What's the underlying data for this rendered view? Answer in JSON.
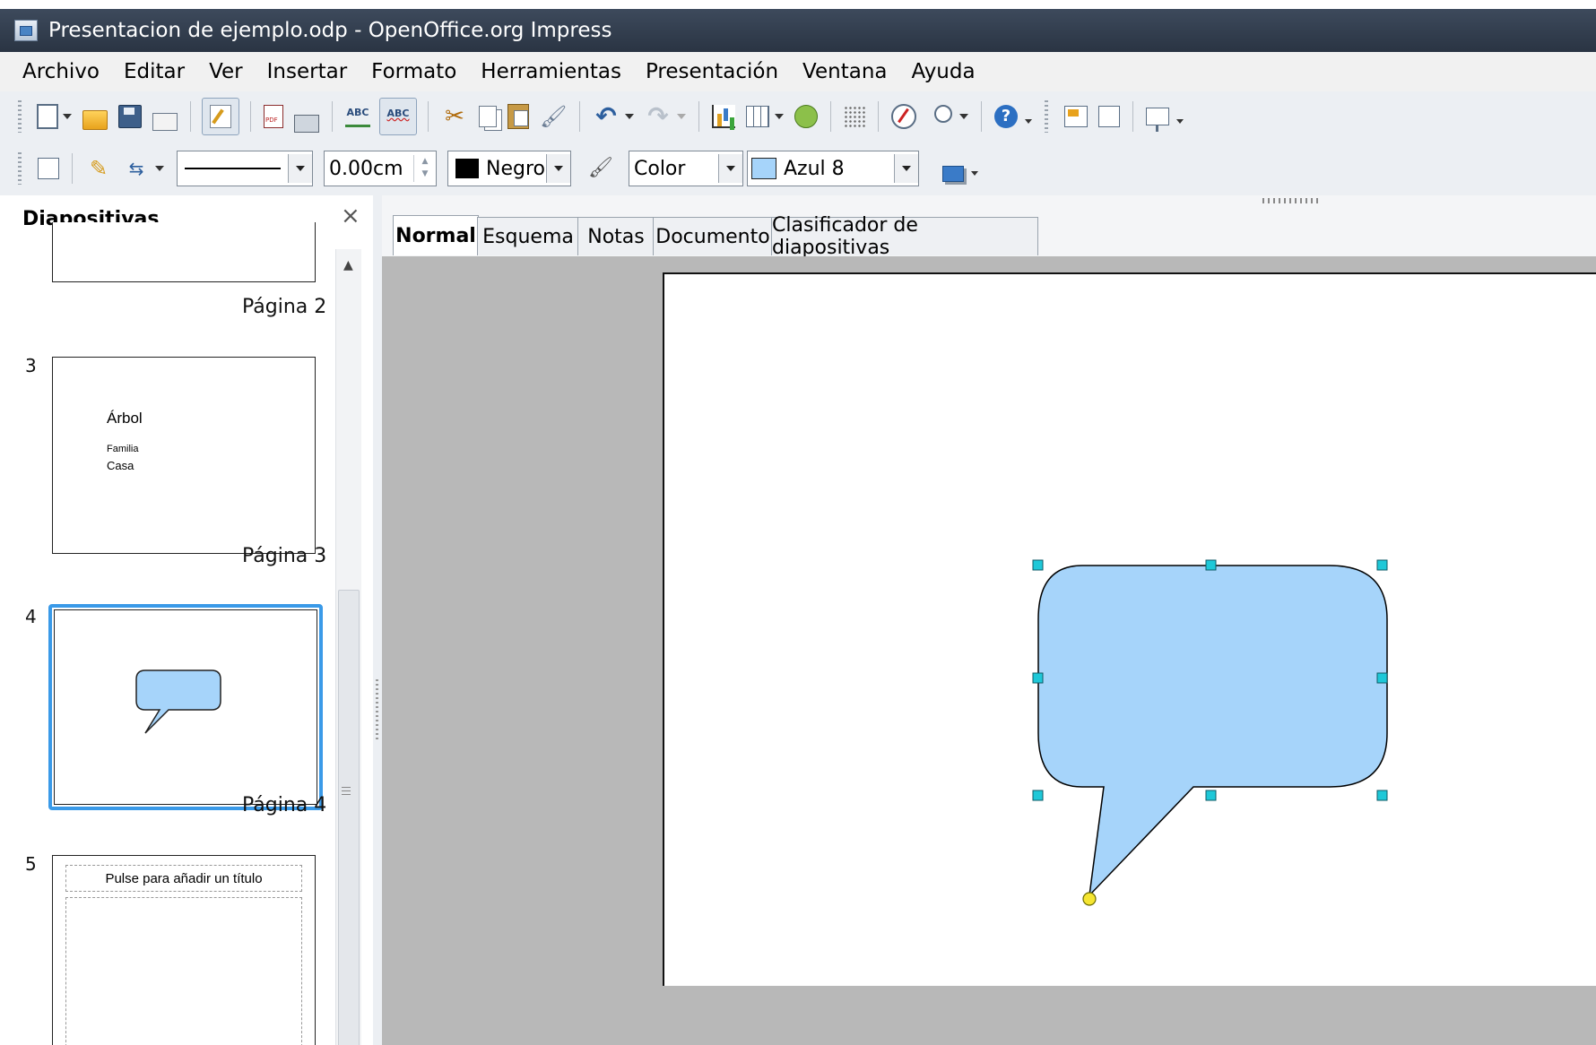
{
  "window": {
    "title": "Presentacion de ejemplo.odp - OpenOffice.org Impress"
  },
  "menu": [
    "Archivo",
    "Editar",
    "Ver",
    "Insertar",
    "Formato",
    "Herramientas",
    "Presentación",
    "Ventana",
    "Ayuda"
  ],
  "line_toolbar": {
    "line_width": "0.00cm",
    "line_color": "Negro",
    "line_color_hex": "#000000",
    "area_style": "Color",
    "area_color": "Azul 8",
    "area_color_hex": "#a6d4fa"
  },
  "slides_panel": {
    "title": "Diapositivas",
    "close_symbol": "×",
    "slides": [
      {
        "number": "",
        "label": "Página 2"
      },
      {
        "number": "3",
        "label": "Página 3",
        "lines": [
          "Árbol",
          "Familia",
          "Casa"
        ]
      },
      {
        "number": "4",
        "label": "Página 4"
      },
      {
        "number": "5",
        "label": "",
        "placeholder": "Pulse para añadir un título"
      }
    ]
  },
  "view_tabs": [
    "Normal",
    "Esquema",
    "Notas",
    "Documento",
    "Clasificador de diapositivas"
  ],
  "shape": {
    "type": "rounded-rectangular-callout",
    "fill": "#a6d4fa",
    "stroke": "#000000",
    "handle_color": "#1ec8d8",
    "anchor_color": "#f5e531"
  },
  "icons": [
    "app-icon",
    "new-icon",
    "open-folder-icon",
    "save-icon",
    "email-icon",
    "edit-file-icon",
    "export-pdf-icon",
    "print-icon",
    "spellcheck-icon",
    "autospellcheck-icon",
    "cut-icon",
    "copy-icon",
    "paste-icon",
    "format-paintbrush-icon",
    "undo-icon",
    "redo-icon",
    "chart-icon",
    "table-icon",
    "fontwork-icon",
    "grid-icon",
    "navigator-icon",
    "zoom-icon",
    "help-icon",
    "slide-icon",
    "slide-design-icon",
    "slideshow-icon"
  ]
}
